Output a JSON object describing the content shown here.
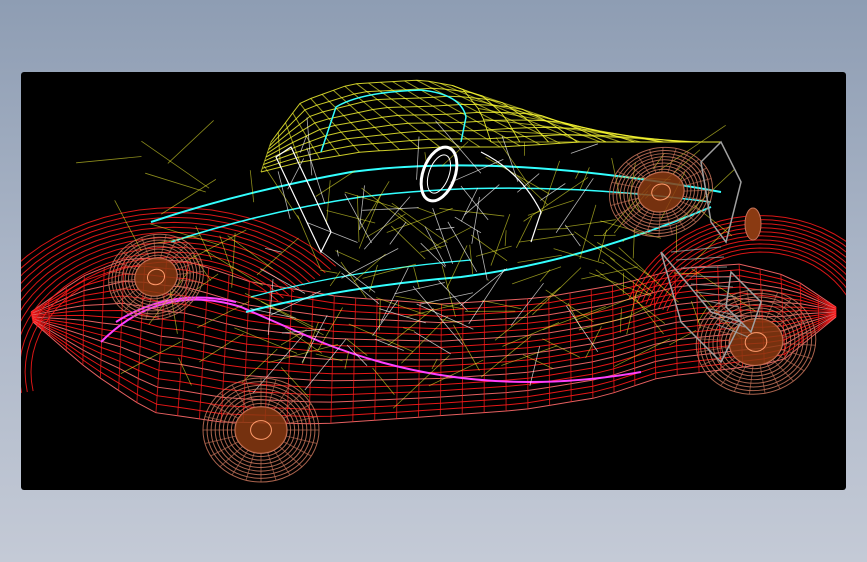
{
  "viewer": {
    "background_color": "#000000",
    "model": "wireframe-car",
    "wire_colors": {
      "body": "#ff1a1a",
      "body_light": "#ff6a6a",
      "trim": "#ff40ff",
      "roof": "#ffff33",
      "belt_line": "#33ffff",
      "interior": "#ffffff",
      "wheels": "#c8745a",
      "hub": "#8a3a12",
      "suspension": "#a0a0a0"
    }
  }
}
